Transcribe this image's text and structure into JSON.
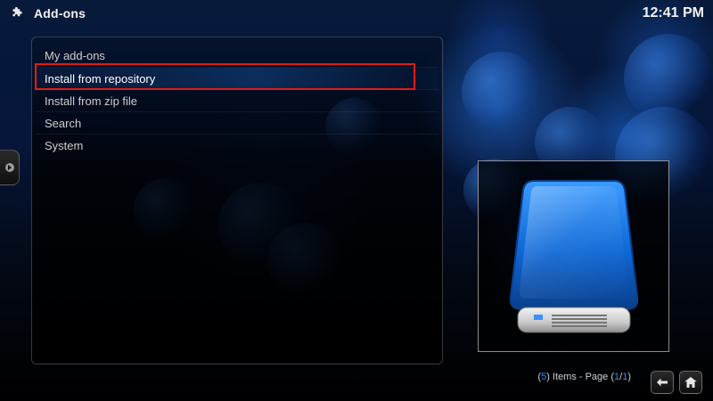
{
  "header": {
    "title": "Add-ons",
    "clock": "12:41 PM",
    "icon": "puzzle-icon"
  },
  "sidebar_tab": {
    "icon": "arrow-right-icon"
  },
  "menu": {
    "items": [
      {
        "label": "My add-ons"
      },
      {
        "label": "Install from repository"
      },
      {
        "label": "Install from zip file"
      },
      {
        "label": "Search"
      },
      {
        "label": "System"
      }
    ],
    "selected_index": 1
  },
  "footer": {
    "items_count": "5",
    "items_label": "Items - Page",
    "page_current": "1",
    "page_total": "1",
    "buttons": {
      "back_icon": "back-arrow-icon",
      "home_icon": "home-icon"
    }
  },
  "colors": {
    "highlight_red": "#e01c17",
    "accent_blue": "#2f8cff"
  },
  "preview": {
    "icon": "hard-drive-icon"
  }
}
